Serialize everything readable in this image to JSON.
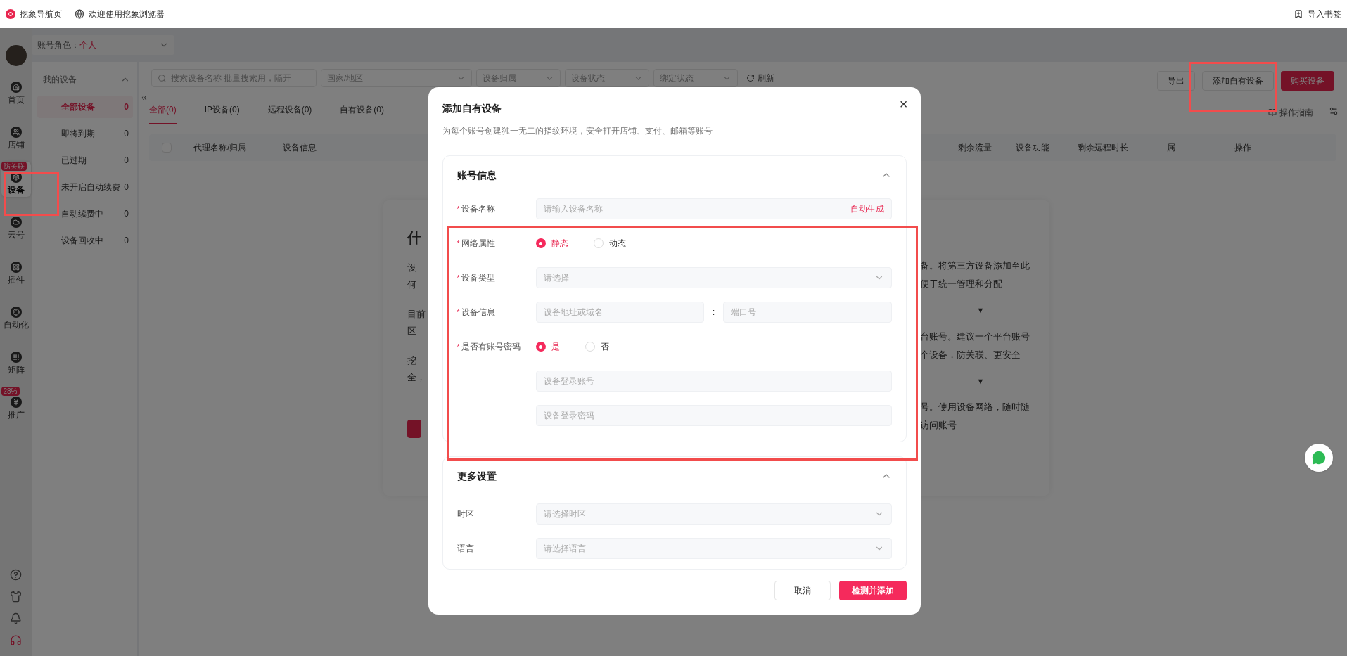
{
  "browser_bar": {
    "tabs": [
      {
        "title": "挖象导航页"
      },
      {
        "title": "欢迎使用挖象浏览器"
      }
    ],
    "import_bookmarks": "导入书签"
  },
  "sidebar": {
    "items": [
      {
        "label": "首页",
        "selected": false
      },
      {
        "label": "店铺",
        "selected": false
      },
      {
        "label": "设备",
        "selected": true,
        "badge": "防关联"
      },
      {
        "label": "云号",
        "selected": false
      },
      {
        "label": "插件",
        "selected": false
      },
      {
        "label": "自动化",
        "selected": false
      },
      {
        "label": "矩阵",
        "selected": false
      },
      {
        "label": "推广",
        "selected": false,
        "badge": "28%"
      }
    ]
  },
  "account_role": {
    "label": "账号角色：",
    "value": "个人"
  },
  "device_menu": {
    "title": "我的设备",
    "expanded": true,
    "items": [
      {
        "label": "全部设备",
        "count": "0",
        "selected": true
      },
      {
        "label": "即将到期",
        "count": "0",
        "selected": false
      },
      {
        "label": "已过期",
        "count": "0",
        "selected": false
      },
      {
        "label": "未开启自动续费",
        "count": "0",
        "selected": false
      },
      {
        "label": "自动续费中",
        "count": "0",
        "selected": false
      },
      {
        "label": "设备回收中",
        "count": "0",
        "selected": false
      }
    ]
  },
  "toolbar": {
    "collapse": "«",
    "search": {
      "placeholder": "搜索设备名称  批量搜索用，隔开"
    },
    "filters": [
      {
        "placeholder": "国家/地区"
      },
      {
        "placeholder": "设备归属"
      },
      {
        "placeholder": "设备状态"
      },
      {
        "placeholder": "绑定状态"
      }
    ],
    "refresh": "刷新",
    "buttons": [
      {
        "label": "导出",
        "kind": "default"
      },
      {
        "label": "添加自有设备",
        "kind": "default"
      },
      {
        "label": "购买设备",
        "kind": "primary"
      }
    ],
    "guide": "操作指南"
  },
  "tabs": [
    {
      "label": "全部(0)",
      "selected": true
    },
    {
      "label": "IP设备(0)",
      "selected": false
    },
    {
      "label": "远程设备(0)",
      "selected": false
    },
    {
      "label": "自有设备(0)",
      "selected": false
    }
  ],
  "table": {
    "select_all": {
      "checked": false
    },
    "columns": [
      "代理名称/归属",
      "设备信息",
      "剩余流量",
      "设备功能",
      "剩余远程时长",
      "属",
      "操作"
    ]
  },
  "info_card": {
    "title": "什",
    "left_lines": [
      "设",
      "何",
      "目前",
      "区",
      "挖",
      "全，"
    ],
    "right_blocks": [
      [
        "备。将第三方设备添加至此",
        "便于统一管理和分配"
      ],
      [
        "台账号。建议一个平台账号",
        "个设备，防关联、更安全"
      ],
      [
        "号。使用设备网络，随时随",
        "访问账号"
      ]
    ],
    "arrow": "▼"
  },
  "modal": {
    "required_mark": "*",
    "title": "添加自有设备",
    "subtitle": "为每个账号创建独一无二的指纹环境，安全打开店铺、支付、邮箱等账号",
    "close": "×",
    "sections": [
      {
        "title": "账号信息",
        "expanded": true,
        "fields": [
          {
            "kind": "text",
            "label": "设备名称",
            "required": true,
            "placeholder": "请输入设备名称",
            "action": "自动生成"
          },
          {
            "kind": "radio",
            "label": "网络属性",
            "required": true,
            "options": [
              {
                "label": "静态",
                "selected": true
              },
              {
                "label": "动态",
                "selected": false
              }
            ]
          },
          {
            "kind": "select",
            "label": "设备类型",
            "required": true,
            "placeholder": "请选择"
          },
          {
            "kind": "pair",
            "label": "设备信息",
            "required": true,
            "placeholders": [
              "设备地址或域名",
              "端口号"
            ],
            "separator": ":"
          },
          {
            "kind": "radio",
            "label": "是否有账号密码",
            "required": true,
            "options": [
              {
                "label": "是",
                "selected": true
              },
              {
                "label": "否",
                "selected": false
              }
            ]
          },
          {
            "kind": "text",
            "placeholder": "设备登录账号"
          },
          {
            "kind": "text",
            "placeholder": "设备登录密码"
          }
        ]
      },
      {
        "title": "更多设置",
        "expanded": true,
        "fields": [
          {
            "kind": "select",
            "label": "时区",
            "required": false,
            "placeholder": "请选择时区"
          },
          {
            "kind": "select",
            "label": "语言",
            "required": false,
            "placeholder": "请选择语言"
          }
        ]
      }
    ],
    "cancel": "取消",
    "submit": "检测并添加"
  }
}
